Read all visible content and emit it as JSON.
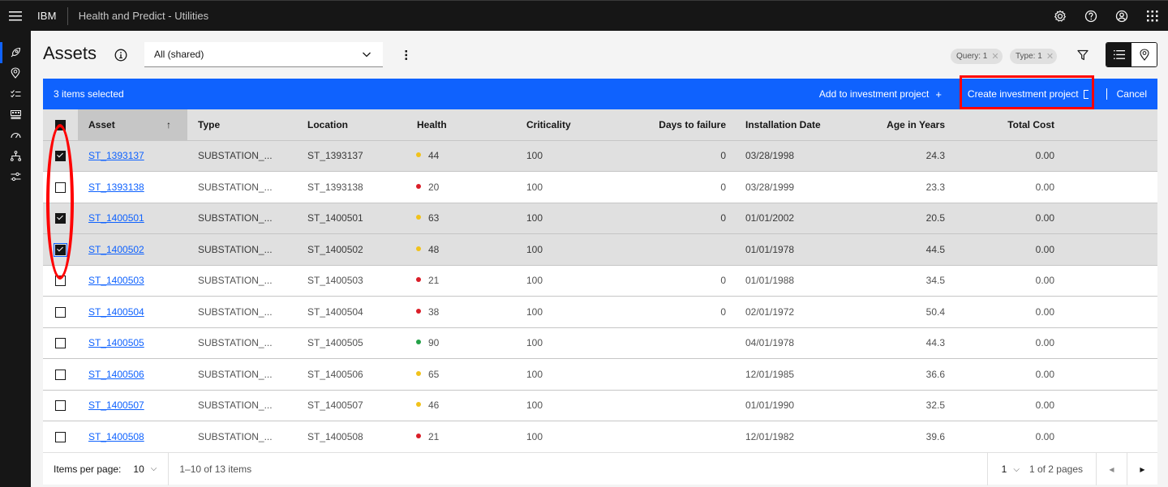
{
  "header": {
    "brand": "IBM",
    "app_name": "Health and Predict - Utilities",
    "actions": [
      "settings-icon",
      "help-icon",
      "user-avatar-icon",
      "app-switcher-icon"
    ]
  },
  "sidenav": {
    "items": [
      {
        "name": "assets",
        "icon": "rocket-icon",
        "active": true
      },
      {
        "name": "locations",
        "icon": "location-icon",
        "active": false
      },
      {
        "name": "tasks",
        "icon": "checklist-icon",
        "active": false
      },
      {
        "name": "dashboard",
        "icon": "dashboard-icon",
        "active": false
      },
      {
        "name": "meter",
        "icon": "meter-icon",
        "active": false
      },
      {
        "name": "hierarchy",
        "icon": "hierarchy-icon",
        "active": false
      },
      {
        "name": "settings",
        "icon": "sliders-icon",
        "active": false
      }
    ]
  },
  "page": {
    "title": "Assets",
    "view_select": "All (shared)",
    "tags": [
      {
        "label": "Query: 1"
      },
      {
        "label": "Type: 1"
      }
    ]
  },
  "batch": {
    "count_label": "3 items selected",
    "add_label": "Add to investment project",
    "add_icon": "+",
    "create_label": "Create investment project",
    "cancel_label": "Cancel"
  },
  "table": {
    "columns": [
      "Asset",
      "Type",
      "Location",
      "Health",
      "Criticality",
      "Days to failure",
      "Installation Date",
      "Age in Years",
      "Total Cost"
    ],
    "sorted_column": "Asset",
    "sort_direction": "ascending",
    "rows": [
      {
        "selected": true,
        "asset": "ST_1393137",
        "type": "SUBSTATION_...",
        "location": "ST_1393137",
        "health": "44",
        "health_color": "#f1c21b",
        "criticality": "100",
        "days": "0",
        "install": "03/28/1998",
        "age": "24.3",
        "cost": "0.00"
      },
      {
        "selected": false,
        "asset": "ST_1393138",
        "type": "SUBSTATION_...",
        "location": "ST_1393138",
        "health": "20",
        "health_color": "#da1e28",
        "criticality": "100",
        "days": "0",
        "install": "03/28/1999",
        "age": "23.3",
        "cost": "0.00"
      },
      {
        "selected": true,
        "asset": "ST_1400501",
        "type": "SUBSTATION_...",
        "location": "ST_1400501",
        "health": "63",
        "health_color": "#f1c21b",
        "criticality": "100",
        "days": "0",
        "install": "01/01/2002",
        "age": "20.5",
        "cost": "0.00"
      },
      {
        "selected": true,
        "focused": true,
        "asset": "ST_1400502",
        "type": "SUBSTATION_...",
        "location": "ST_1400502",
        "health": "48",
        "health_color": "#f1c21b",
        "criticality": "100",
        "days": "",
        "install": "01/01/1978",
        "age": "44.5",
        "cost": "0.00"
      },
      {
        "selected": false,
        "asset": "ST_1400503",
        "type": "SUBSTATION_...",
        "location": "ST_1400503",
        "health": "21",
        "health_color": "#da1e28",
        "criticality": "100",
        "days": "0",
        "install": "01/01/1988",
        "age": "34.5",
        "cost": "0.00"
      },
      {
        "selected": false,
        "asset": "ST_1400504",
        "type": "SUBSTATION_...",
        "location": "ST_1400504",
        "health": "38",
        "health_color": "#da1e28",
        "criticality": "100",
        "days": "0",
        "install": "02/01/1972",
        "age": "50.4",
        "cost": "0.00"
      },
      {
        "selected": false,
        "asset": "ST_1400505",
        "type": "SUBSTATION_...",
        "location": "ST_1400505",
        "health": "90",
        "health_color": "#24a148",
        "criticality": "100",
        "days": "",
        "install": "04/01/1978",
        "age": "44.3",
        "cost": "0.00"
      },
      {
        "selected": false,
        "asset": "ST_1400506",
        "type": "SUBSTATION_...",
        "location": "ST_1400506",
        "health": "65",
        "health_color": "#f1c21b",
        "criticality": "100",
        "days": "",
        "install": "12/01/1985",
        "age": "36.6",
        "cost": "0.00"
      },
      {
        "selected": false,
        "asset": "ST_1400507",
        "type": "SUBSTATION_...",
        "location": "ST_1400507",
        "health": "46",
        "health_color": "#f1c21b",
        "criticality": "100",
        "days": "",
        "install": "01/01/1990",
        "age": "32.5",
        "cost": "0.00"
      },
      {
        "selected": false,
        "asset": "ST_1400508",
        "type": "SUBSTATION_...",
        "location": "ST_1400508",
        "health": "21",
        "health_color": "#da1e28",
        "criticality": "100",
        "days": "",
        "install": "12/01/1982",
        "age": "39.6",
        "cost": "0.00"
      }
    ]
  },
  "pagination": {
    "items_per_page_label": "Items per page:",
    "items_per_page": "10",
    "range": "1–10 of 13 items",
    "page": "1",
    "of_pages": "1 of 2 pages"
  },
  "colors": {
    "accent": "#0f62fe",
    "annotation": "#ff0000",
    "header_bg": "#161616"
  }
}
